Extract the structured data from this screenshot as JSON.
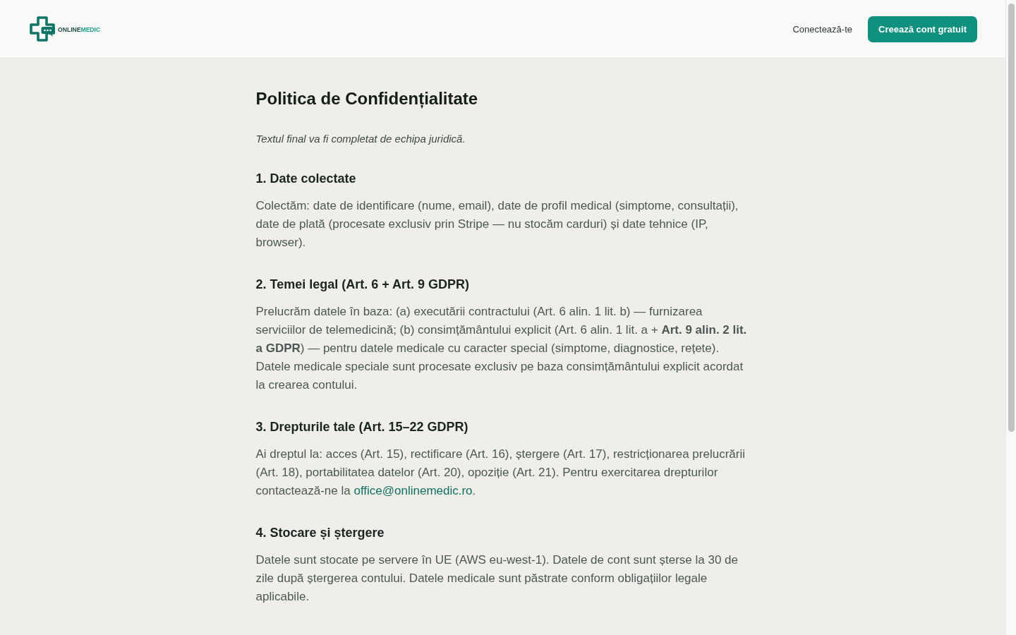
{
  "header": {
    "logo": {
      "wordmark": [
        {
          "text": "ONLINE",
          "accent": false
        },
        {
          "text": "MEDIC",
          "accent": true
        }
      ]
    },
    "login_link": "Conectează-te",
    "signup_button": "Creează cont gratuit"
  },
  "page": {
    "title": "Politica de Confidențialitate",
    "note": "Textul final va fi completat de echipa juridică.",
    "sections": [
      {
        "heading": "1. Date colectate",
        "body": [
          {
            "kind": "text",
            "text": "Colectăm: date de identificare (nume, email), date de profil medical (simptome, consultații), date de plată (procesate exclusiv prin Stripe — nu stocăm carduri) și date tehnice (IP, browser)."
          }
        ]
      },
      {
        "heading": "2. Temei legal (Art. 6 + Art. 9 GDPR)",
        "body": [
          {
            "kind": "text",
            "text": "Prelucrăm datele în baza: (a) executării contractului (Art. 6 alin. 1 lit. b) — furnizarea serviciilor de telemedicină; (b) consimțământului explicit (Art. 6 alin. 1 lit. a + **Art. 9 alin. 2 lit. a GDPR**) — pentru datele medicale cu caracter special (simptome, diagnostice, rețete). Datele medicale speciale sunt procesate exclusiv pe baza consimțământului explicit acordat la crearea contului."
          }
        ]
      },
      {
        "heading": "3. Drepturile tale (Art. 15–22 GDPR)",
        "body": [
          {
            "kind": "text",
            "text": "Ai dreptul la: acces (Art. 15), rectificare (Art. 16), ștergere (Art. 17), restricționarea prelucrării (Art. 18), portabilitatea datelor (Art. 20), opoziție (Art. 21). Pentru exercitarea drepturilor contactează-ne la "
          },
          {
            "kind": "link",
            "text": "office@onlinemedic.ro"
          },
          {
            "kind": "text",
            "text": "."
          }
        ]
      },
      {
        "heading": "4. Stocare și ștergere",
        "body": [
          {
            "kind": "text",
            "text": "Datele sunt stocate pe servere în UE (AWS eu-west-1). Datele de cont sunt șterse la 30 de zile după ștergerea contului. Datele medicale sunt păstrate conform obligațiilor legale aplicabile."
          }
        ]
      }
    ]
  }
}
